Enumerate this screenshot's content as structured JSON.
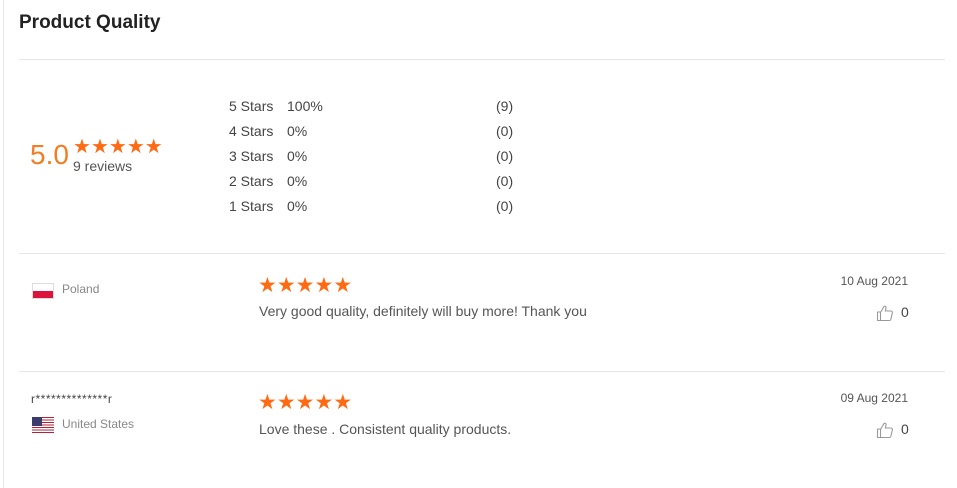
{
  "title": "Product Quality",
  "summary": {
    "average": "5.0",
    "stars": 5,
    "review_count": "9 reviews"
  },
  "distribution": [
    {
      "label": "5  Stars",
      "percent": "100%",
      "count": "(9)"
    },
    {
      "label": "4  Stars",
      "percent": "0%",
      "count": "(0)"
    },
    {
      "label": "3  Stars",
      "percent": "0%",
      "count": "(0)"
    },
    {
      "label": "2  Stars",
      "percent": "0%",
      "count": "(0)"
    },
    {
      "label": "1  Stars",
      "percent": "0%",
      "count": "(0)"
    }
  ],
  "reviews": [
    {
      "user": "",
      "country": "Poland",
      "flag": "flag-poland-icon",
      "stars": 5,
      "text": "Very good quality, definitely will buy more! Thank you",
      "date": "10 Aug 2021",
      "likes": "0"
    },
    {
      "user": "r**************r",
      "country": "United States",
      "flag": "flag-united-states-icon",
      "stars": 5,
      "text": "Love these . Consistent quality products.",
      "date": "09 Aug 2021",
      "likes": "0"
    }
  ],
  "colors": {
    "star": "#ff6a14",
    "average": "#f27e23"
  }
}
